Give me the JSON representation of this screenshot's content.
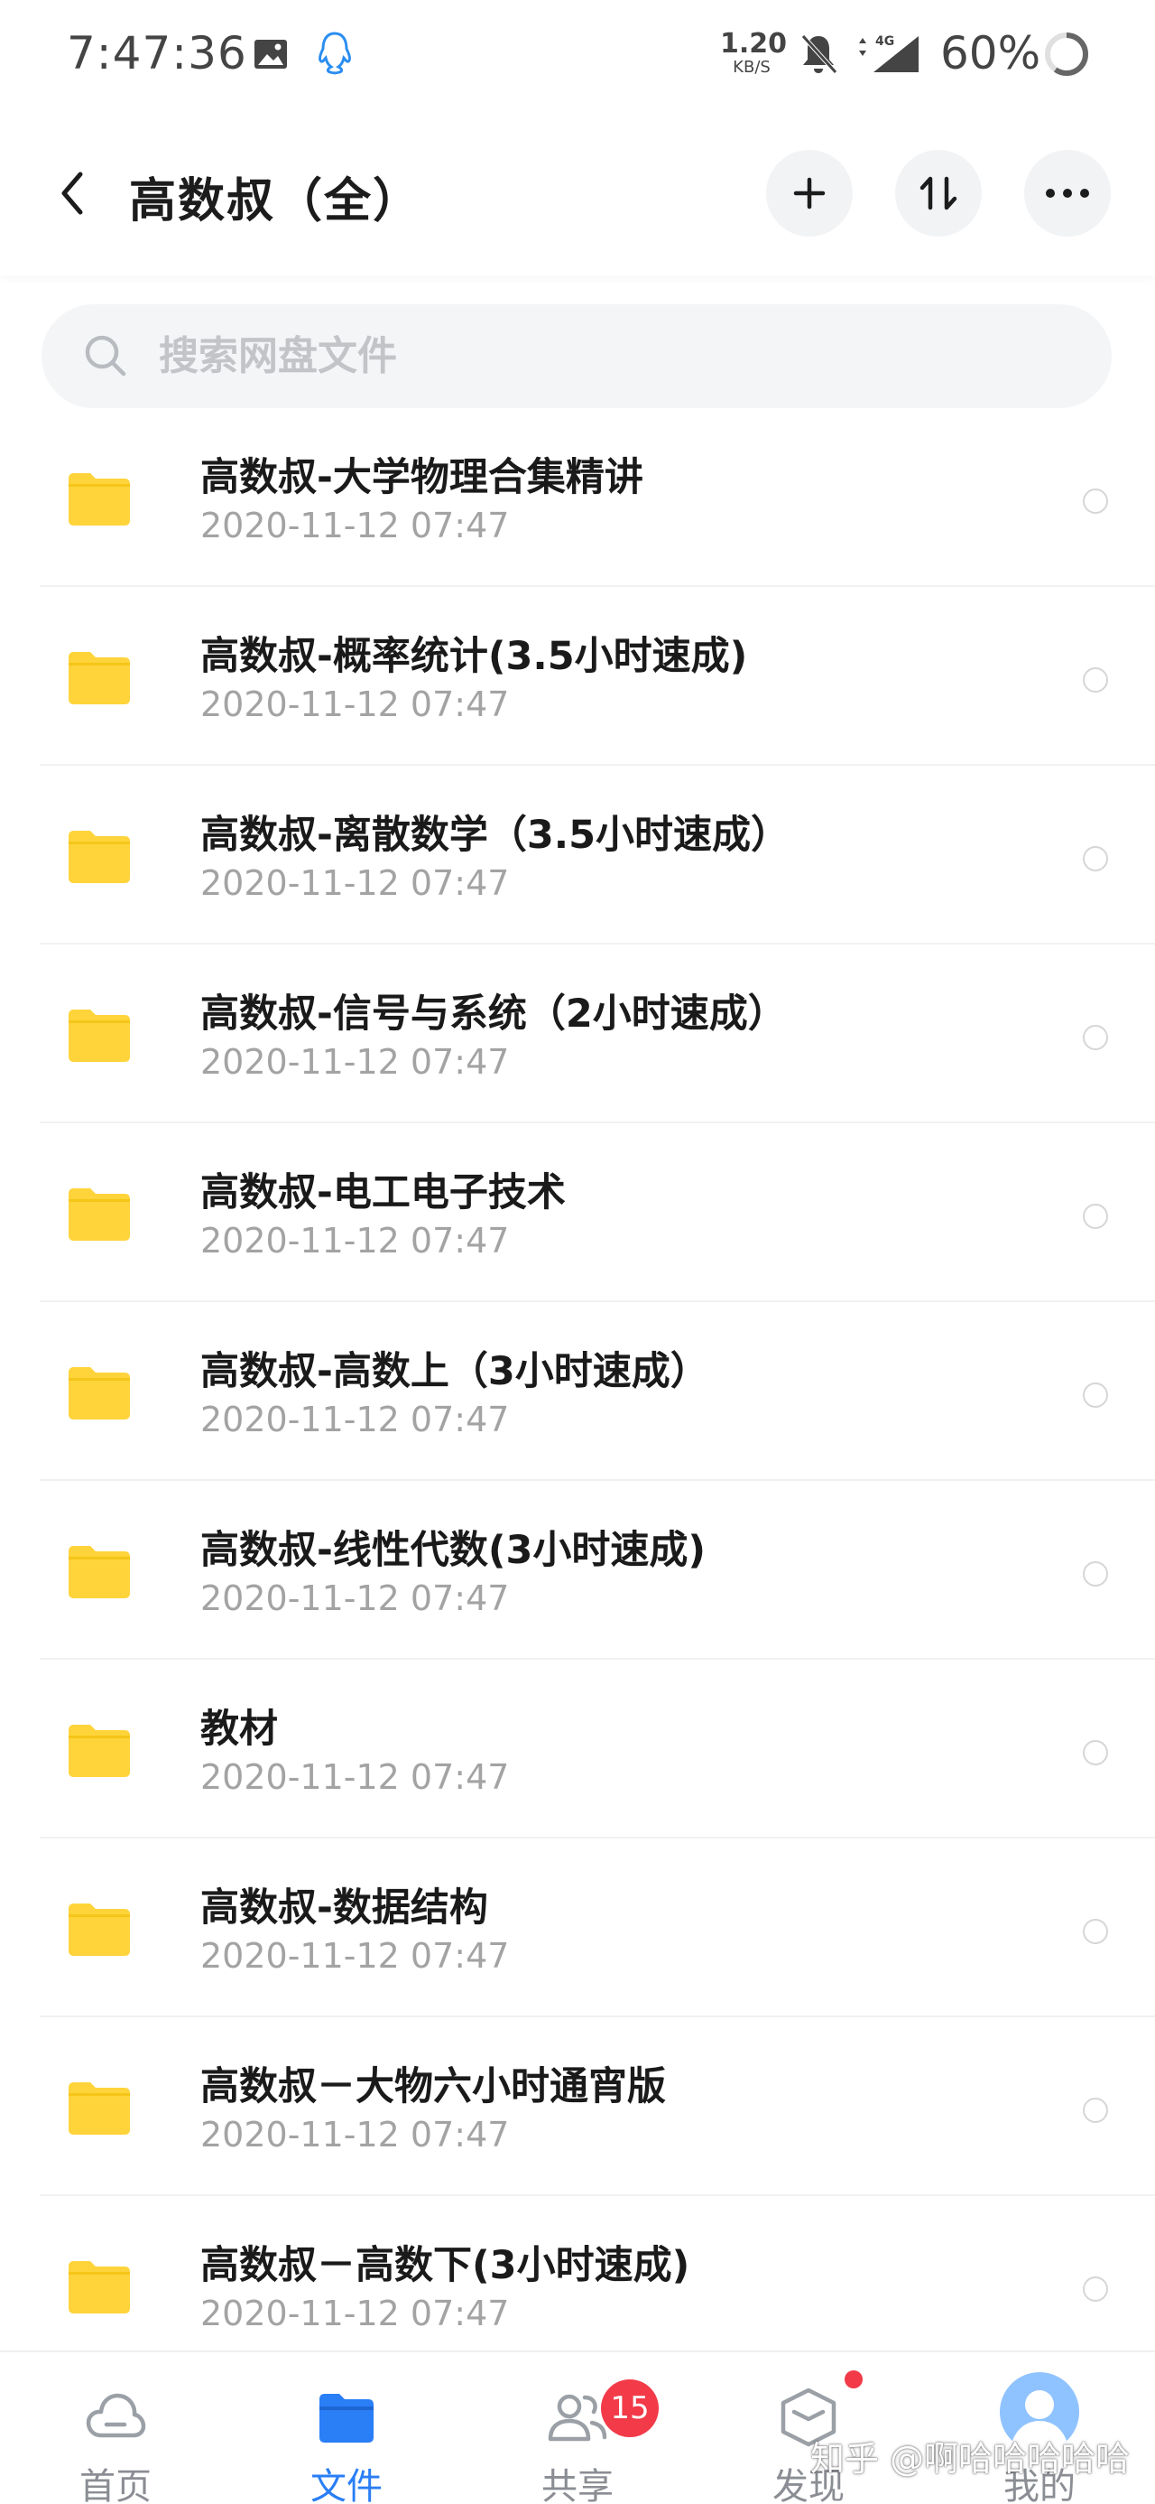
{
  "status_bar": {
    "time": "7:47:36",
    "net_speed_value": "1.20",
    "net_speed_unit": "KB/S",
    "network_label": "4G",
    "battery": "60%"
  },
  "header": {
    "title": "高数叔（全）"
  },
  "search": {
    "placeholder": "搜索网盘文件"
  },
  "files": [
    {
      "name": "高数叔-大学物理合集精讲",
      "date": "2020-11-12  07:47"
    },
    {
      "name": "高数叔-概率统计(3.5小时速成)",
      "date": "2020-11-12  07:47"
    },
    {
      "name": "高数叔-离散数学（3.5小时速成）",
      "date": "2020-11-12  07:47"
    },
    {
      "name": "高数叔-信号与系统（2小时速成）",
      "date": "2020-11-12  07:47"
    },
    {
      "name": "高数叔-电工电子技术",
      "date": "2020-11-12  07:47"
    },
    {
      "name": "高数叔-高数上（3小时速成）",
      "date": "2020-11-12  07:47"
    },
    {
      "name": "高数叔-线性代数(3小时速成)",
      "date": "2020-11-12  07:47"
    },
    {
      "name": "教材",
      "date": "2020-11-12  07:47"
    },
    {
      "name": "高数叔-数据结构",
      "date": "2020-11-12  07:47"
    },
    {
      "name": "高数叔－大物六小时通宵版",
      "date": "2020-11-12  07:47"
    },
    {
      "name": "高数叔－高数下(3小时速成)",
      "date": "2020-11-12  07:47"
    }
  ],
  "bottom_nav": {
    "items": [
      {
        "label": "首页",
        "icon": "cloud-icon"
      },
      {
        "label": "文件",
        "icon": "folder-icon",
        "active": true
      },
      {
        "label": "共享",
        "icon": "people-icon"
      },
      {
        "label": "发现",
        "icon": "cube-icon"
      },
      {
        "label": "我的",
        "icon": "avatar-icon"
      }
    ],
    "share_badge": "15"
  },
  "watermark": "知乎 @啊哈哈哈哈哈",
  "colors": {
    "accent": "#2a7ef6",
    "folder": "#ffd43b",
    "badge": "#f23a48"
  }
}
